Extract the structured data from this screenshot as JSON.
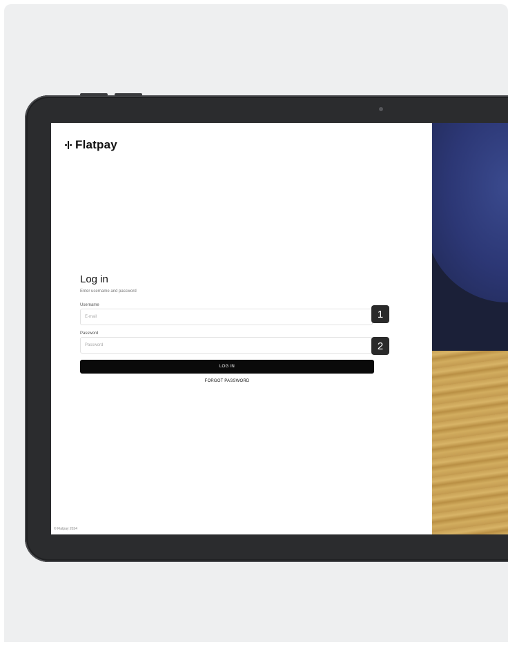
{
  "brand": {
    "name": "Flatpay"
  },
  "login": {
    "title": "Log in",
    "subtitle": "Enter username and password",
    "username_label": "Username",
    "username_placeholder": "E-mail",
    "password_label": "Password",
    "password_placeholder": "Password",
    "login_button": "LOG IN",
    "forgot_password": "FORGOT PASSWORD"
  },
  "footer": {
    "copyright": "© Flatpay 2024"
  },
  "annotations": {
    "badge_1": "1",
    "badge_2": "2"
  }
}
